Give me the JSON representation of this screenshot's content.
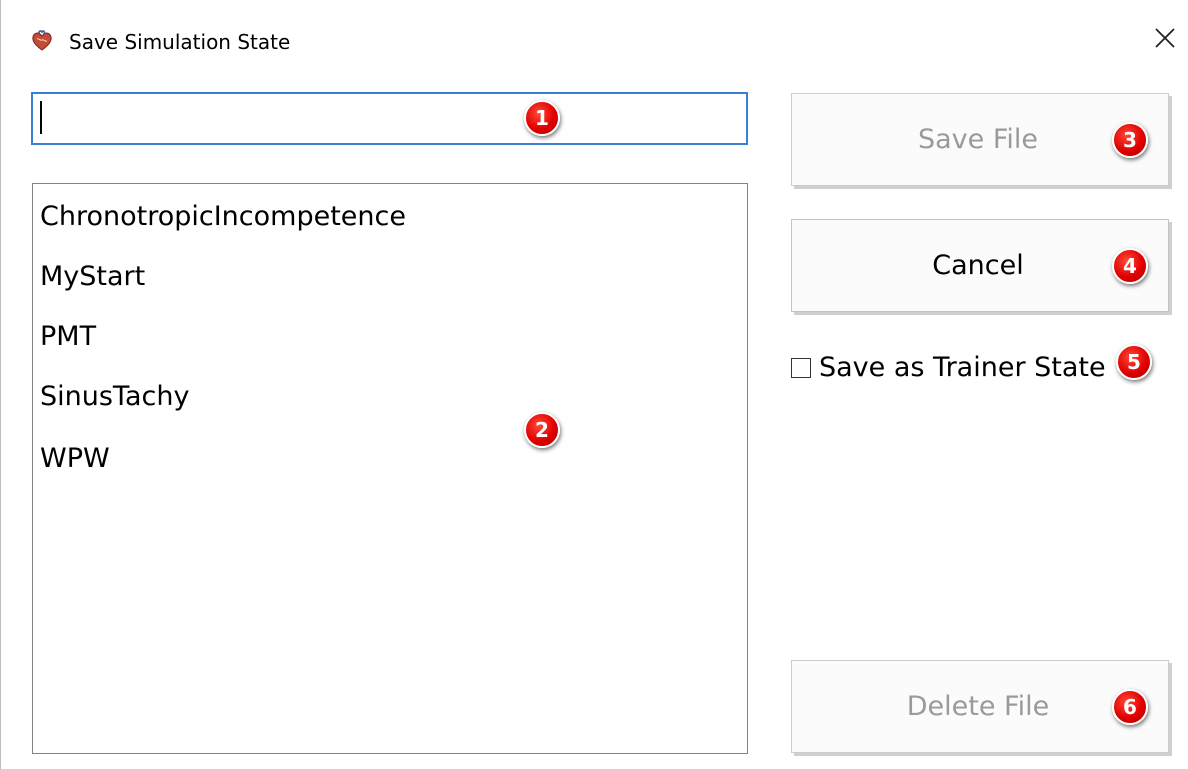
{
  "window": {
    "title": "Save Simulation State",
    "close_glyph": "✕"
  },
  "filename_input": {
    "value": "",
    "placeholder": ""
  },
  "file_list": {
    "items": [
      "ChronotropicIncompetence",
      "MyStart",
      "PMT",
      "SinusTachy",
      "WPW"
    ]
  },
  "buttons": {
    "save_label": "Save File",
    "save_enabled": false,
    "cancel_label": "Cancel",
    "cancel_enabled": true,
    "delete_label": "Delete File",
    "delete_enabled": false
  },
  "trainer_checkbox": {
    "label": "Save as Trainer State",
    "checked": false
  },
  "annotations": [
    "1",
    "2",
    "3",
    "4",
    "5",
    "6"
  ],
  "colors": {
    "input_focus_border": "#3a7fd5",
    "disabled_text": "#9a9a9a",
    "badge_red": "#e00000"
  }
}
